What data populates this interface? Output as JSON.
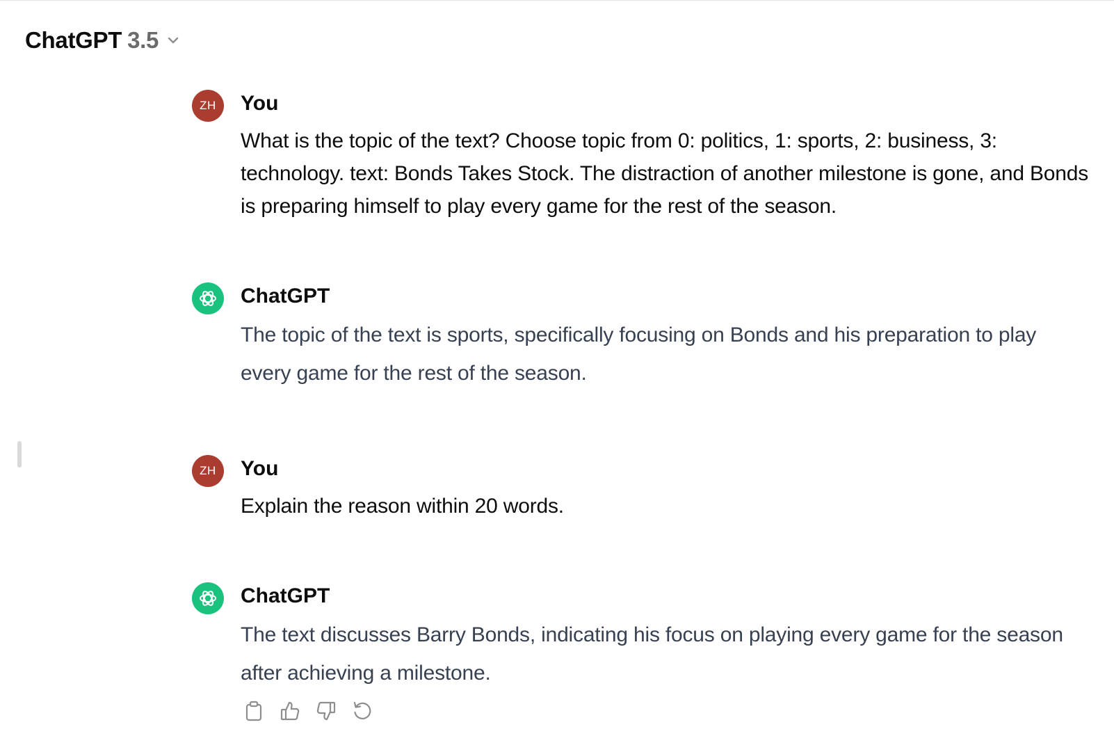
{
  "header": {
    "model_name": "ChatGPT",
    "model_version": "3.5"
  },
  "conversation": [
    {
      "role": "user",
      "author": "You",
      "avatar_initials": "ZH",
      "text": "What is the topic of the text? Choose topic from 0: politics, 1: sports, 2: business, 3: technology.  text: Bonds Takes Stock. The distraction of another milestone is gone, and Bonds is preparing himself to play every game for the rest of the season."
    },
    {
      "role": "assistant",
      "author": "ChatGPT",
      "avatar_icon": "openai-logo-icon",
      "text": "The topic of the text is sports, specifically focusing on Bonds and his preparation to play every game for the rest of the season."
    },
    {
      "role": "user",
      "author": "You",
      "avatar_initials": "ZH",
      "text": "Explain the reason within 20 words."
    },
    {
      "role": "assistant",
      "author": "ChatGPT",
      "avatar_icon": "openai-logo-icon",
      "text": "The text discusses Barry Bonds, indicating his focus on playing every game for the season after achieving a milestone."
    }
  ],
  "message_actions": [
    "clipboard-icon",
    "thumbs-up-icon",
    "thumbs-down-icon",
    "regenerate-icon"
  ],
  "colors": {
    "user_avatar": "#ab3c30",
    "assistant_avatar": "#19c37d",
    "assistant_text": "#374151",
    "model_version": "#6b6b6b"
  }
}
